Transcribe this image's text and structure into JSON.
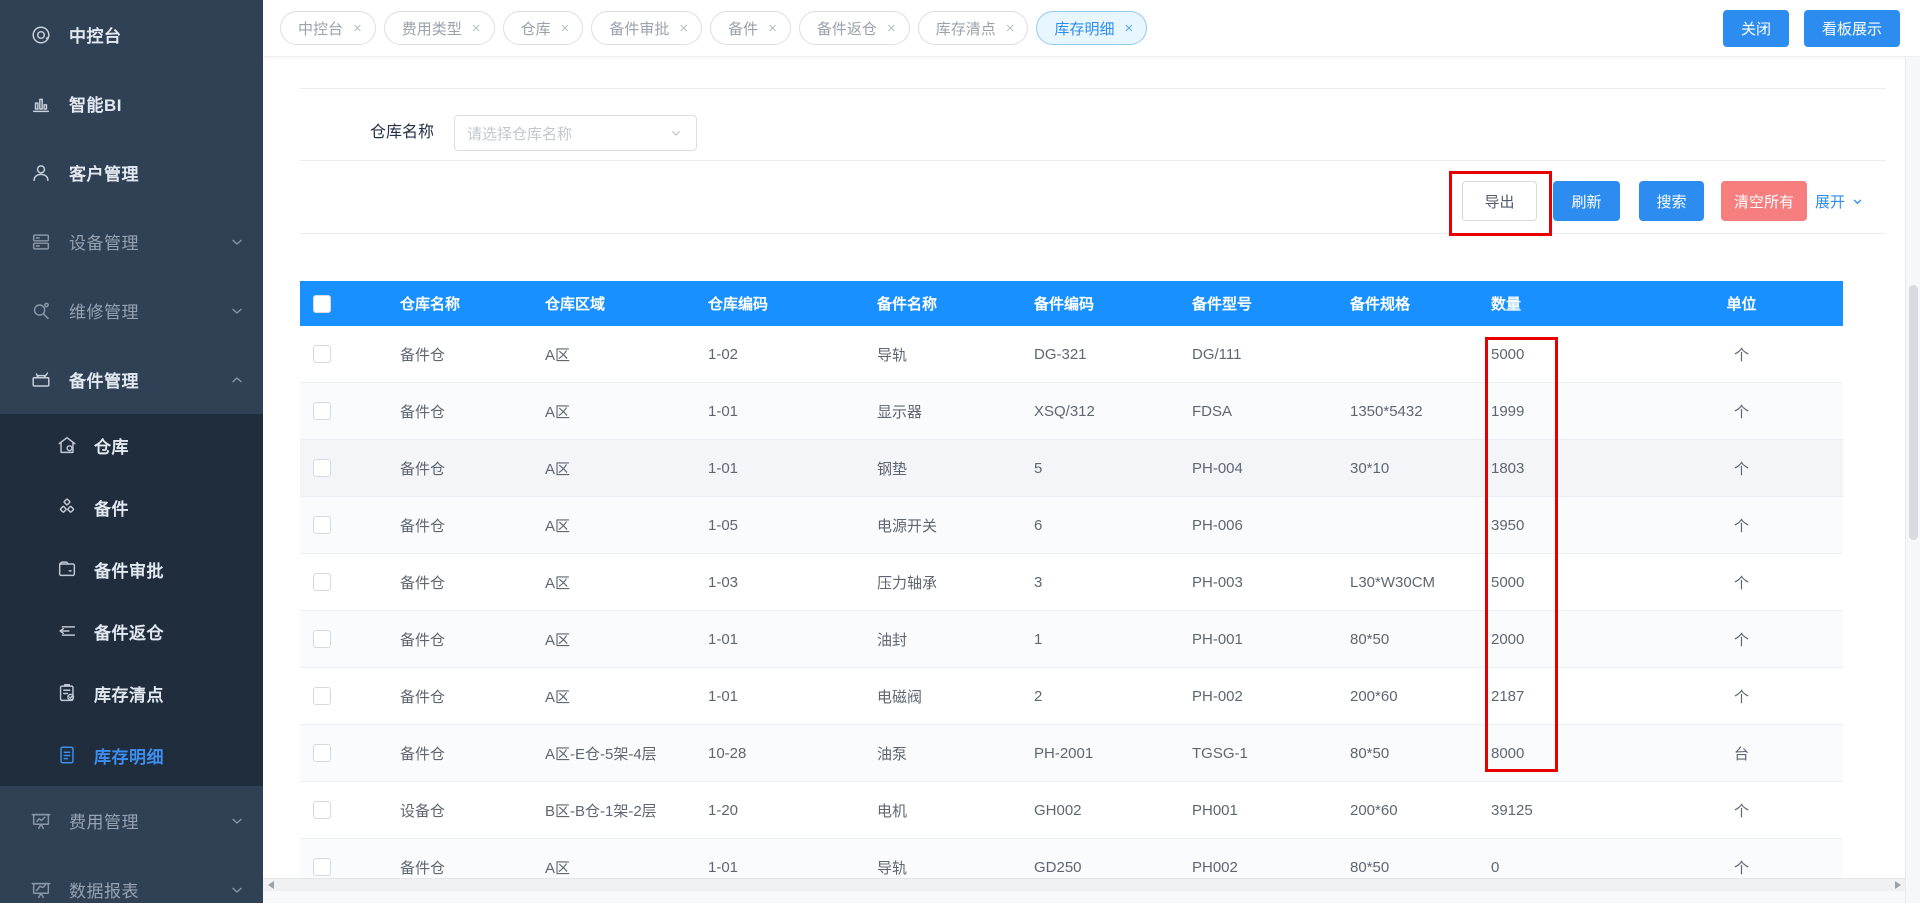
{
  "sidebar": {
    "items": [
      {
        "key": "console",
        "icon": "console",
        "label": "中控台"
      },
      {
        "key": "smart-bi",
        "icon": "bi",
        "label": "智能BI"
      },
      {
        "key": "customer-mgmt",
        "icon": "customer",
        "label": "客户管理"
      },
      {
        "key": "device-mgmt",
        "icon": "device",
        "label": "设备管理",
        "chevron": "down",
        "dim": true
      },
      {
        "key": "repair-mgmt",
        "icon": "repair",
        "label": "维修管理",
        "chevron": "down",
        "dim": true
      },
      {
        "key": "spare-parts-mgmt",
        "icon": "toolbox",
        "label": "备件管理",
        "chevron": "up",
        "children": [
          {
            "key": "warehouse",
            "icon": "warehouse",
            "label": "仓库"
          },
          {
            "key": "spare-parts",
            "icon": "cubes",
            "label": "备件"
          },
          {
            "key": "parts-approval",
            "icon": "approval",
            "label": "备件审批"
          },
          {
            "key": "parts-return",
            "icon": "return",
            "label": "备件返仓"
          },
          {
            "key": "stock-count",
            "icon": "stocktake",
            "label": "库存清点"
          },
          {
            "key": "stock-detail",
            "icon": "document",
            "label": "库存明细",
            "active": true
          }
        ]
      },
      {
        "key": "expense-mgmt",
        "icon": "expense",
        "label": "费用管理",
        "chevron": "down",
        "dim": true
      },
      {
        "key": "data-report",
        "icon": "report",
        "label": "数据报表",
        "chevron": "down",
        "dim": true
      }
    ]
  },
  "tabbar": {
    "close_glyph": "×",
    "tabs": [
      {
        "key": "console",
        "label": "中控台"
      },
      {
        "key": "expense-type",
        "label": "费用类型"
      },
      {
        "key": "warehouse",
        "label": "仓库"
      },
      {
        "key": "parts-approval",
        "label": "备件审批"
      },
      {
        "key": "parts",
        "label": "备件"
      },
      {
        "key": "parts-return",
        "label": "备件返仓"
      },
      {
        "key": "stock-count",
        "label": "库存清点"
      },
      {
        "key": "stock-detail",
        "label": "库存明细",
        "active": true
      }
    ],
    "close_label": "关闭",
    "board_label": "看板展示"
  },
  "filter": {
    "label": "仓库名称",
    "placeholder": "请选择仓库名称"
  },
  "actions": {
    "export": "导出",
    "refresh": "刷新",
    "search": "搜索",
    "clear": "清空所有",
    "expand": "展开"
  },
  "table": {
    "columns": [
      "仓库名称",
      "仓库区域",
      "仓库编码",
      "备件名称",
      "备件编码",
      "备件型号",
      "备件规格",
      "数量",
      "单位"
    ],
    "rows": [
      [
        "备件仓",
        "A区",
        "1-02",
        "导轨",
        "DG-321",
        "DG/111",
        "",
        "5000",
        "个"
      ],
      [
        "备件仓",
        "A区",
        "1-01",
        "显示器",
        "XSQ/312",
        "FDSA",
        "1350*5432",
        "1999",
        "个"
      ],
      [
        "备件仓",
        "A区",
        "1-01",
        "钢垫",
        "5",
        "PH-004",
        "30*10",
        "1803",
        "个"
      ],
      [
        "备件仓",
        "A区",
        "1-05",
        "电源开关",
        "6",
        "PH-006",
        "",
        "3950",
        "个"
      ],
      [
        "备件仓",
        "A区",
        "1-03",
        "压力轴承",
        "3",
        "PH-003",
        "L30*W30CM",
        "5000",
        "个"
      ],
      [
        "备件仓",
        "A区",
        "1-01",
        "油封",
        "1",
        "PH-001",
        "80*50",
        "2000",
        "个"
      ],
      [
        "备件仓",
        "A区",
        "1-01",
        "电磁阀",
        "2",
        "PH-002",
        "200*60",
        "2187",
        "个"
      ],
      [
        "备件仓",
        "A区-E仓-5架-4层",
        "10-28",
        "油泵",
        "PH-2001",
        "TGSG-1",
        "80*50",
        "8000",
        "台"
      ],
      [
        "设备仓",
        "B区-B仓-1架-2层",
        "1-20",
        "电机",
        "GH002",
        "PH001",
        "200*60",
        "39125",
        "个"
      ],
      [
        "备件仓",
        "A区",
        "1-01",
        "导轨",
        "GD250",
        "PH002",
        "80*50",
        "0",
        "个"
      ]
    ]
  },
  "colors": {
    "accent_blue": "#2d8cf0",
    "table_header_blue": "#1890ff",
    "clear_button_red": "#f77e7e",
    "annotation_red": "#e60000",
    "sidebar_bg": "#304156",
    "sidebar_submenu_bg": "#1f2d3d",
    "active_menu_blue": "#3d8ef0"
  },
  "annotations": {
    "color": "#e60000",
    "marked": [
      "export-button",
      "quantity-column-rows-1-8"
    ]
  }
}
